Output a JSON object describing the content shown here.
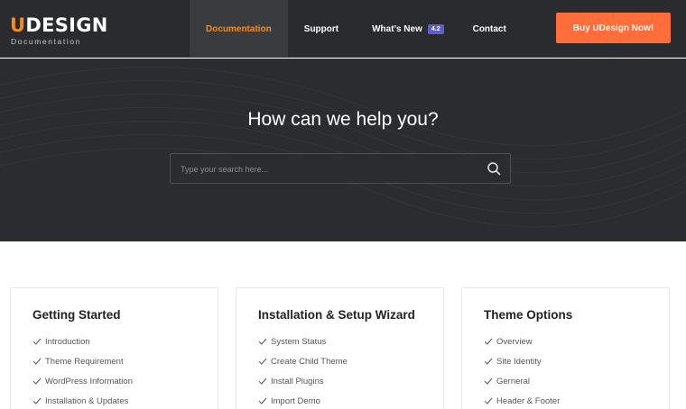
{
  "logo": {
    "u": "U",
    "rest": "DESIGN",
    "subtitle": "Documentation"
  },
  "nav": [
    {
      "label": "Documentation"
    },
    {
      "label": "Support"
    },
    {
      "label": "What’s New",
      "badge": "4.2"
    },
    {
      "label": "Contact"
    }
  ],
  "buy_button": "Buy UDesign Now!",
  "hero": {
    "title": "How can we help you?",
    "search_placeholder": "Type your search here..."
  },
  "cards": [
    {
      "title": "Getting Started",
      "items": [
        "Introduction",
        "Theme Requirement",
        "WordPress Information",
        "Installation & Updates"
      ]
    },
    {
      "title": "Installation & Setup Wizard",
      "items": [
        "System Status",
        "Create Child Theme",
        "Install Plugins",
        "Import Demo"
      ]
    },
    {
      "title": "Theme Options",
      "items": [
        "Overview",
        "Site Identity",
        "Gerneral",
        "Header & Footer"
      ]
    }
  ],
  "colors": {
    "accent": "#f28a29",
    "button": "#fe6e3a",
    "header_bg": "#2a2b2f",
    "badge": "#5b5fc7"
  }
}
